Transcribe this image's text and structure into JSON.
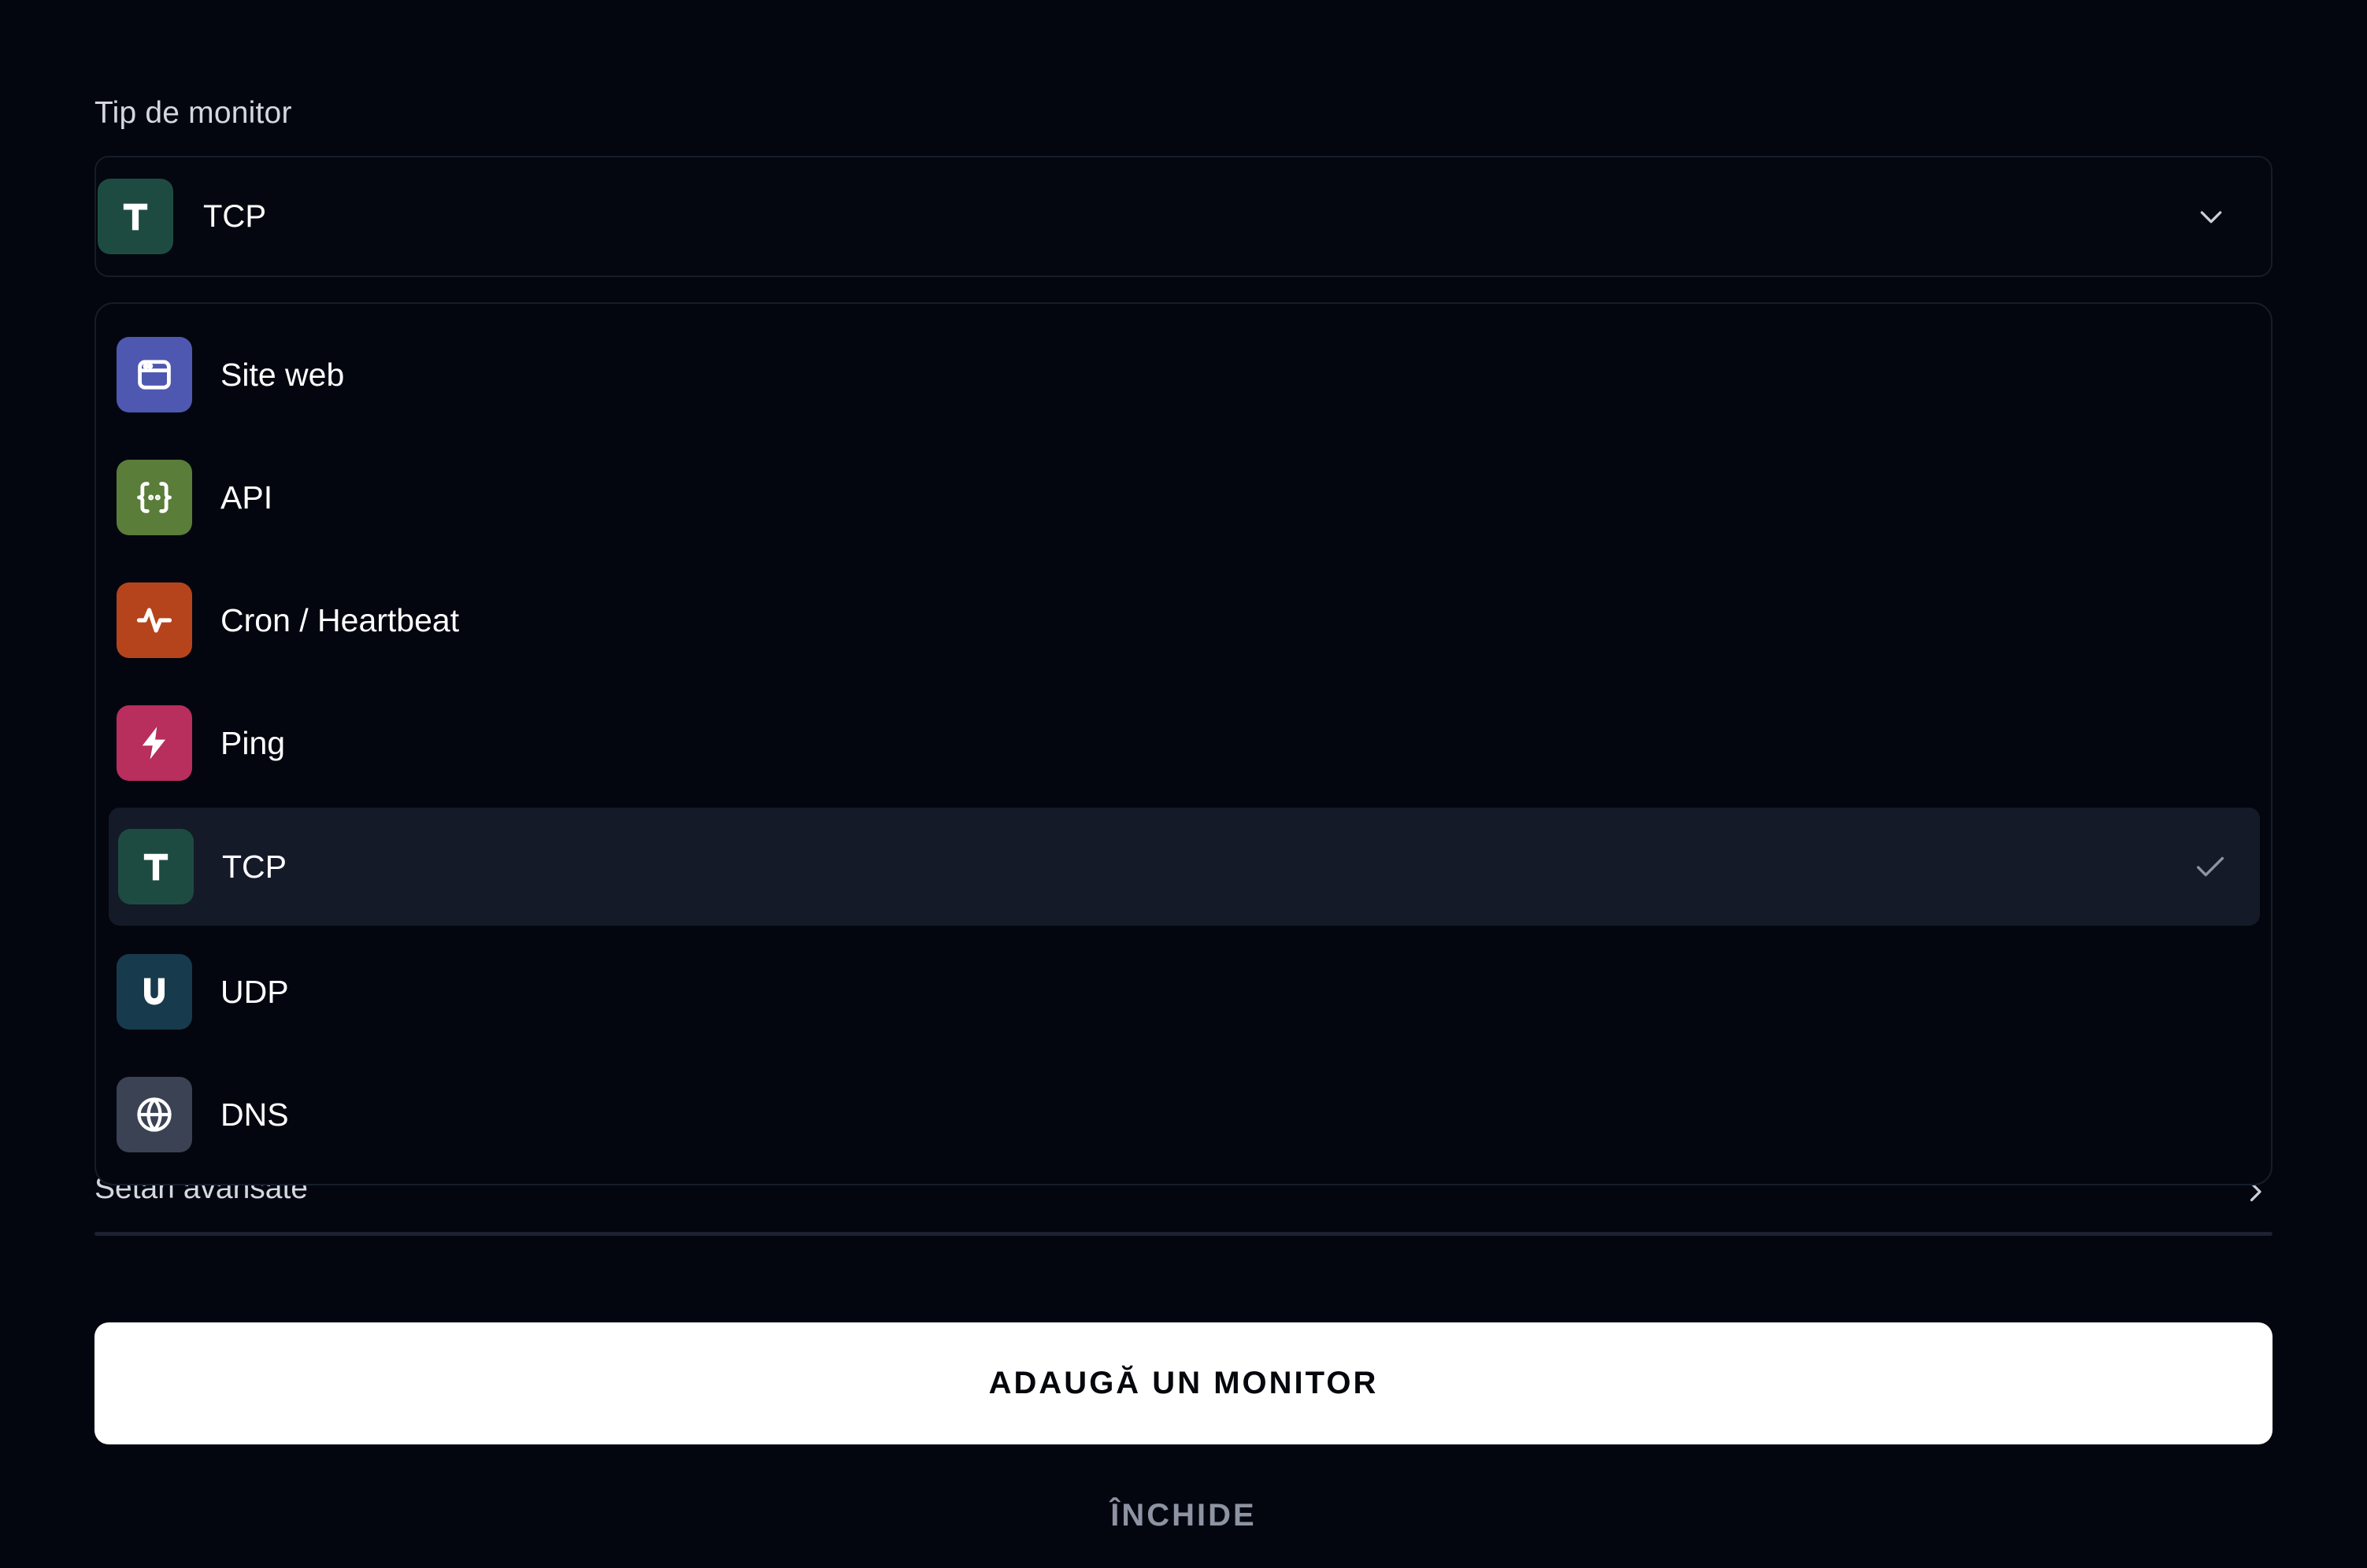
{
  "form": {
    "monitor_type_label": "Tip de monitor",
    "selected": {
      "letter": "T",
      "label": "TCP",
      "color": "#1d4b42",
      "icon": "letter-t-icon"
    }
  },
  "dropdown": {
    "options": [
      {
        "label": "Site web",
        "icon": "browser-window-icon",
        "color": "#4f58b0",
        "selected": false
      },
      {
        "label": "API",
        "icon": "curly-braces-icon",
        "color": "#5a7d3a",
        "selected": false
      },
      {
        "label": "Cron / Heartbeat",
        "icon": "activity-pulse-icon",
        "color": "#b5441c",
        "selected": false
      },
      {
        "label": "Ping",
        "icon": "lightning-bolt-icon",
        "color": "#b82e5d",
        "selected": false
      },
      {
        "label": "TCP",
        "icon": "letter-t-icon",
        "letter": "T",
        "color": "#1d4b42",
        "selected": true
      },
      {
        "label": "UDP",
        "icon": "letter-u-icon",
        "letter": "U",
        "color": "#183a4d",
        "selected": false
      },
      {
        "label": "DNS",
        "icon": "globe-icon",
        "color": "#3a4254",
        "selected": false
      }
    ]
  },
  "advanced": {
    "label": "Setări avansate"
  },
  "actions": {
    "primary_label": "ADAUGĂ UN MONITOR",
    "secondary_label": "ÎNCHIDE"
  }
}
